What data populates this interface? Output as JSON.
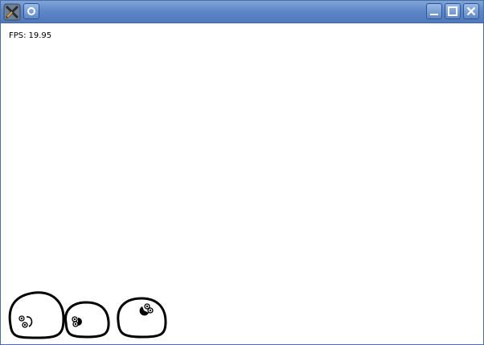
{
  "window": {
    "title": "",
    "buttons": {
      "minimize": "minimize-icon",
      "maximize": "maximize-icon",
      "close": "close-icon"
    },
    "colors": {
      "titlebar": "#5f88c8",
      "border": "#4a6fa5"
    }
  },
  "hud": {
    "fps_label": "FPS:",
    "fps_value": "19.95"
  },
  "scene": {
    "background": "#ffffff",
    "blob_count": 3,
    "outline_color": "#000000"
  }
}
